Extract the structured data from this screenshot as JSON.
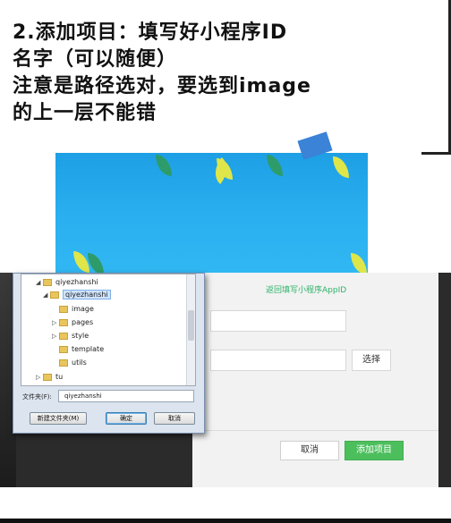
{
  "caption": {
    "line1": "2.添加项目：填写好小程序ID",
    "line2": "名字（可以随便）",
    "line3": "注意是路径选对，要选到image",
    "line4": "的上一层不能错"
  },
  "project_dialog": {
    "appid_link": "返回填写小程序AppID",
    "choose_label": "选择",
    "cancel_label": "取消",
    "add_label": "添加项目"
  },
  "folder_dialog": {
    "tree": [
      {
        "label": "qiyezhanshi",
        "expand": "◢"
      },
      {
        "label": "qiyezhanshi",
        "expand": "◢"
      },
      {
        "label": "image",
        "expand": ""
      },
      {
        "label": "pages",
        "expand": "▷"
      },
      {
        "label": "style",
        "expand": "▷"
      },
      {
        "label": "template",
        "expand": ""
      },
      {
        "label": "utils",
        "expand": ""
      },
      {
        "label": "tu",
        "expand": "▷"
      }
    ],
    "folder_label": "文件夹(F):",
    "folder_value": "qiyezhanshi",
    "new_folder_label": "新建文件夹(M)",
    "ok_label": "确定",
    "cancel_label": "取消"
  },
  "colors": {
    "accent_green": "#4cbf5c",
    "link_green": "#2db36a",
    "banner_blue": "#2ab0f0"
  }
}
